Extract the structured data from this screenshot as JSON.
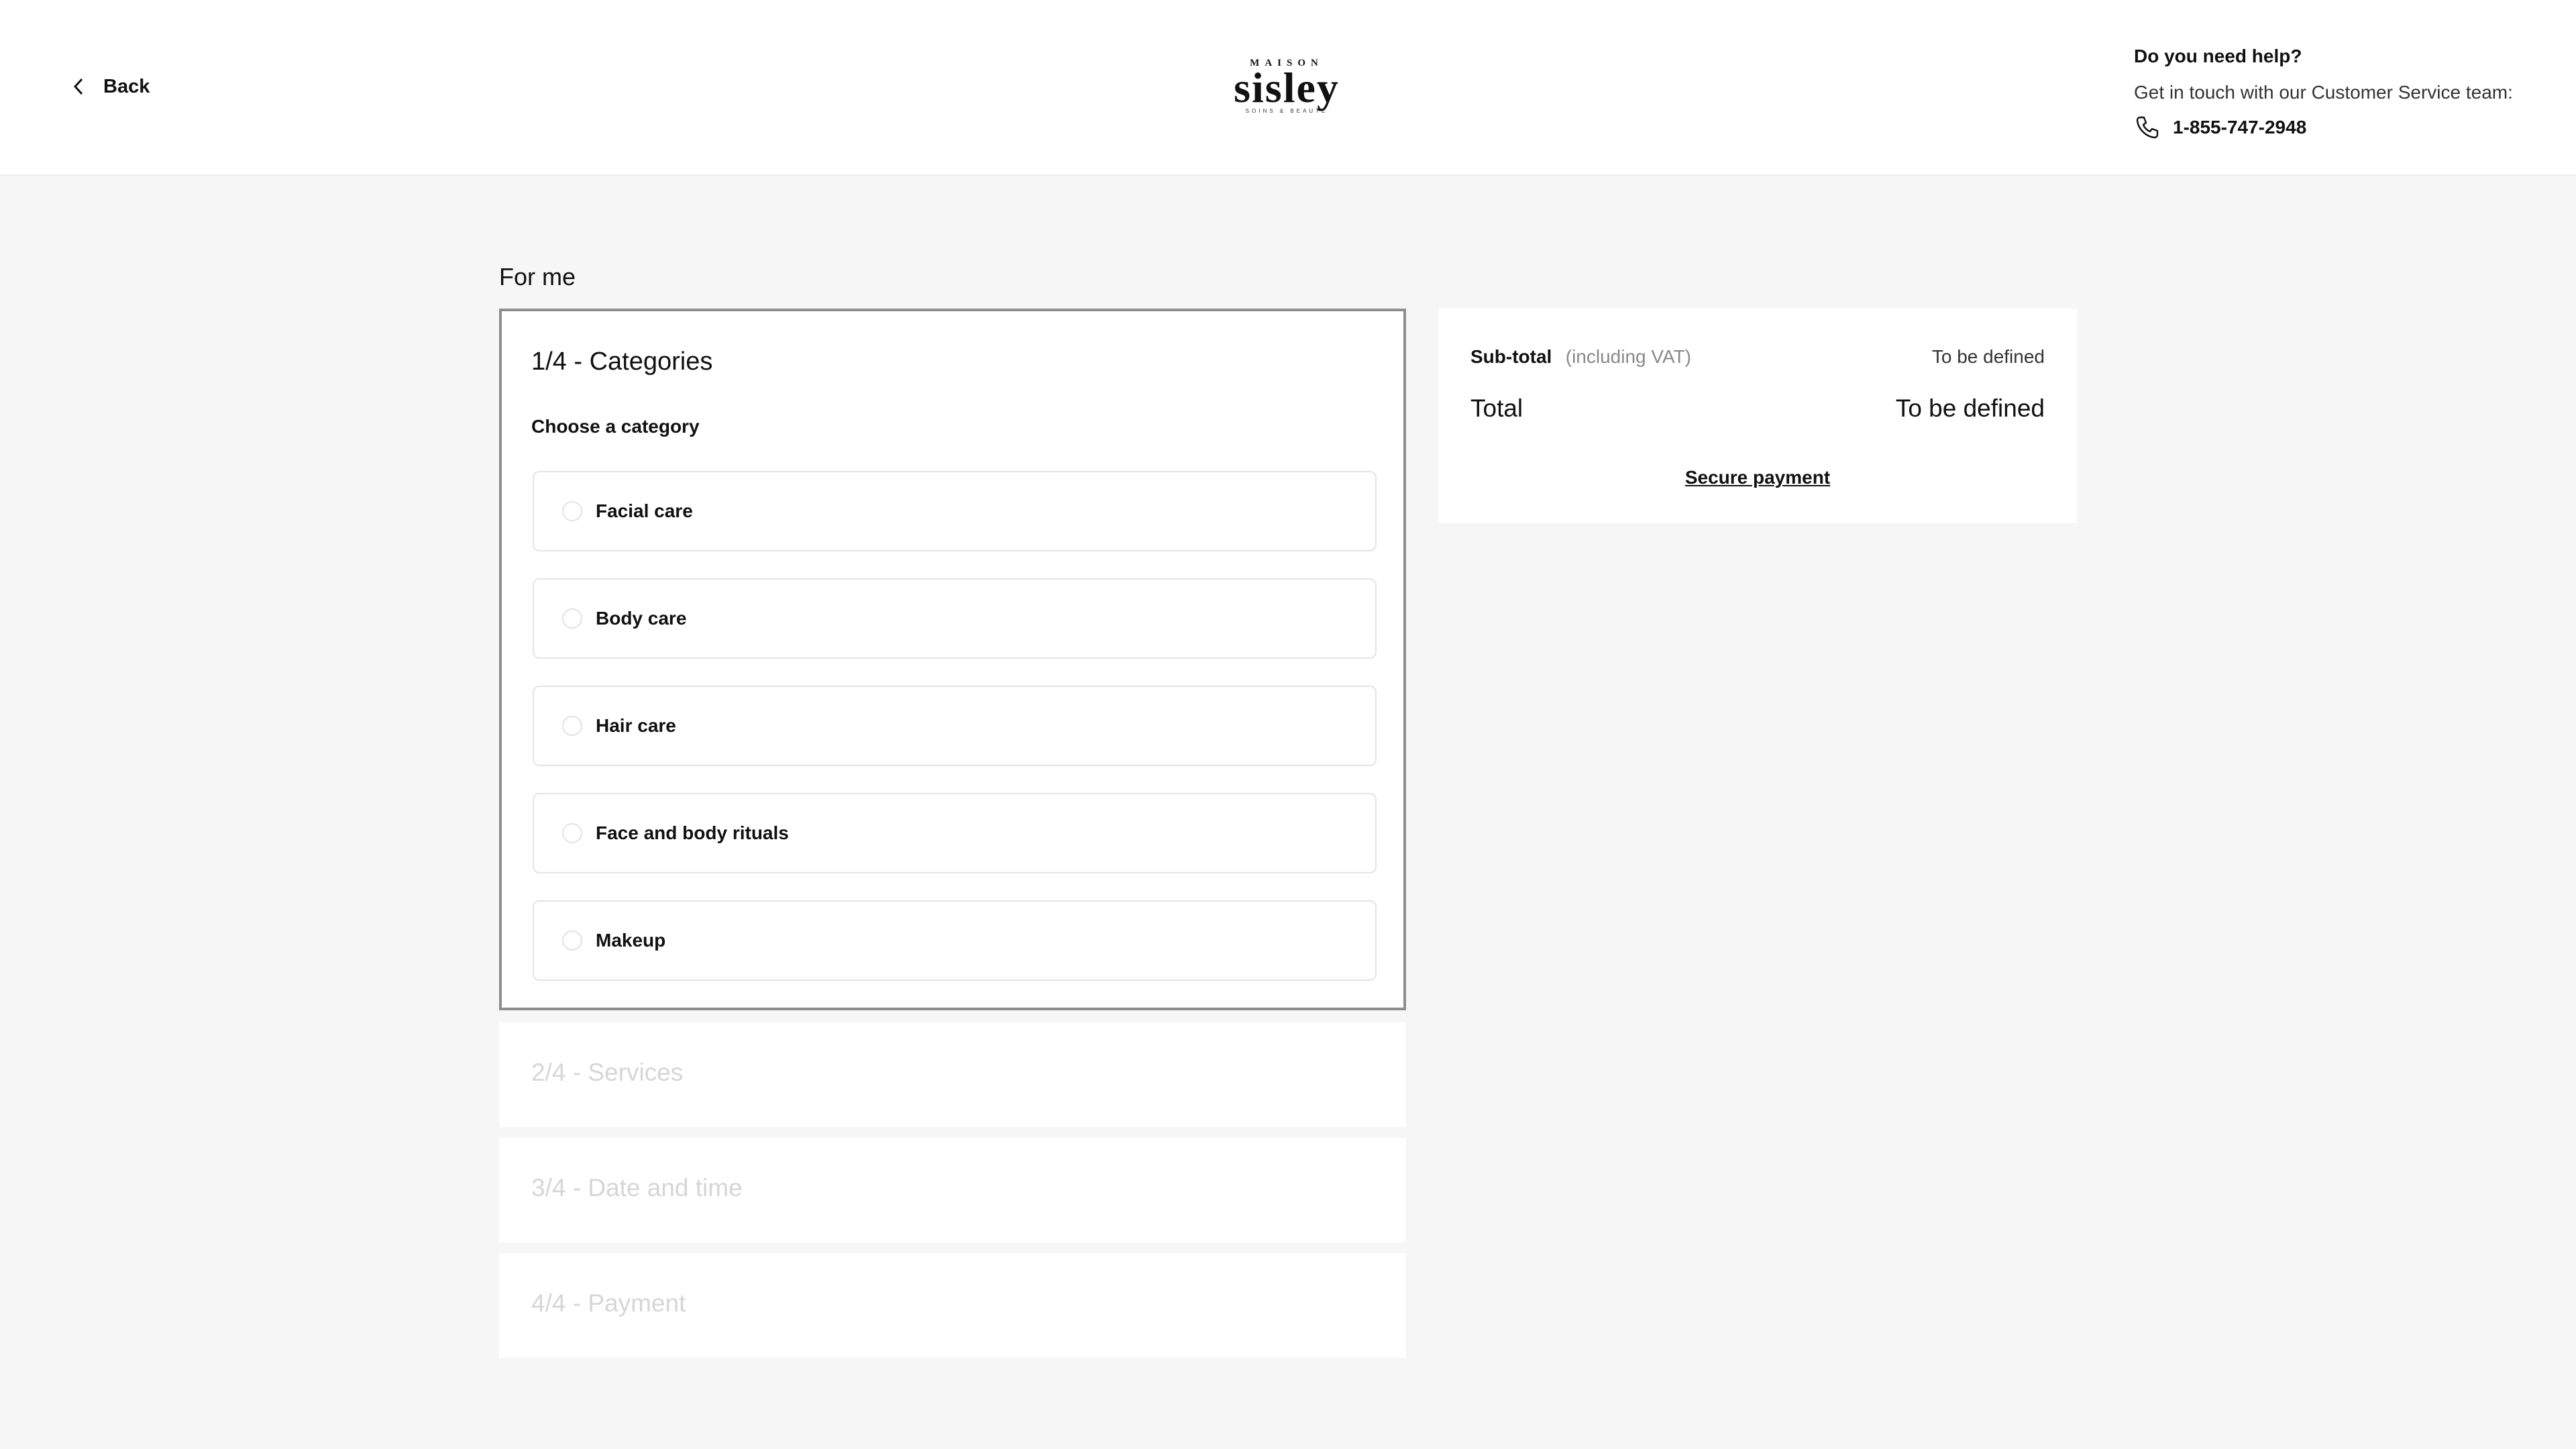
{
  "header": {
    "back_label": "Back",
    "logo": {
      "top": "MAISON",
      "main": "sisley",
      "sub": "SOINS & BEAUTÉ"
    },
    "help": {
      "title": "Do you need help?",
      "text": "Get in touch with our Customer Service team:",
      "phone": "1-855-747-2948"
    }
  },
  "main": {
    "recipient_label": "For me",
    "active_step": {
      "title": "1/4 - Categories",
      "prompt": "Choose a category",
      "options": [
        {
          "label": "Facial care"
        },
        {
          "label": "Body care"
        },
        {
          "label": "Hair care"
        },
        {
          "label": "Face and body rituals"
        },
        {
          "label": "Makeup"
        }
      ]
    },
    "collapsed_steps": [
      {
        "title": "2/4 - Services"
      },
      {
        "title": "3/4 - Date and time"
      },
      {
        "title": "4/4 - Payment"
      }
    ]
  },
  "summary": {
    "subtotal_label": "Sub-total",
    "subtotal_note": "(including VAT)",
    "subtotal_value": "To be defined",
    "total_label": "Total",
    "total_value": "To be defined",
    "secure_payment_label": "Secure payment"
  },
  "colors": {
    "background": "#f6f6f6",
    "panel": "#ffffff",
    "active_border": "#8e8e8e",
    "disabled_text": "#d6d6d6"
  }
}
